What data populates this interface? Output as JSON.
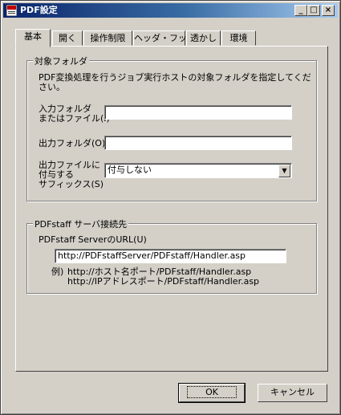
{
  "window": {
    "title": "PDF設定"
  },
  "caption_buttons": {
    "minimize": "_",
    "maximize": "□",
    "close": "×"
  },
  "tabs": [
    "基本",
    "開く",
    "操作制限",
    "ヘッダ・フッタ",
    "透かし",
    "環境"
  ],
  "target_folder": {
    "title": "対象フォルダ",
    "description_line1": "PDF変換処理を行うジョブ実行ホストの対象フォルダを指定してくだ",
    "description_line2": "さい。",
    "input_label_line1": "入力フォルダ",
    "input_label_line2": "またはファイル(I)",
    "input_value": "",
    "output_label": "出力フォルダ(O)",
    "output_value": "",
    "suffix_label_line1": "出力ファイルに",
    "suffix_label_line2": "付与する",
    "suffix_label_line3": "サフィックス(S)",
    "suffix_selected": "付与しない"
  },
  "server": {
    "title": "PDFstaff サーバ接続先",
    "url_label": "PDFstaff ServerのURL(U)",
    "url_value": "http://PDFstaffServer/PDFstaff/Handler.asp",
    "example_prefix": "例)",
    "example_line1": "http://ホスト名ポート/PDFstaff/Handler.asp",
    "example_line2": "http://IPアドレスポート/PDFstaff/Handler.asp"
  },
  "buttons": {
    "ok": "OK",
    "cancel": "キャンセル"
  },
  "colors": {
    "titlebar_start": "#0a246a",
    "titlebar_end": "#a6caf0",
    "face": "#d4d0c8"
  }
}
